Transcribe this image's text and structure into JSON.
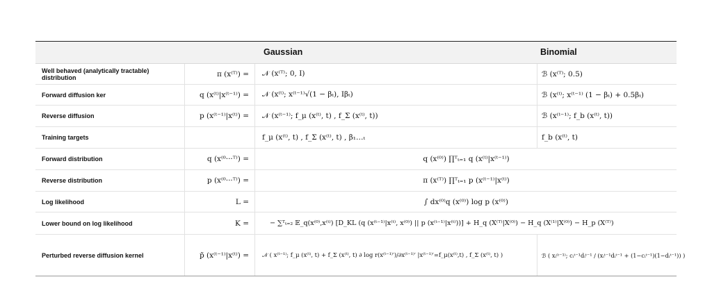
{
  "header": {
    "gaussian": "Gaussian",
    "binomial": "Binomial"
  },
  "rows": [
    {
      "name": "Well behaved (analytically tractable) distribution",
      "symbol": "π (x⁽ᵀ⁾) =",
      "gaussian": "𝒩 (x⁽ᵀ⁾; 0, I)",
      "binomial": "ℬ (x⁽ᵀ⁾; 0.5)"
    },
    {
      "name": "Forward diffusion ker",
      "symbol": "q (x⁽ᵗ⁾|x⁽ᵗ⁻¹⁾) =",
      "gaussian": "𝒩 (x⁽ᵗ⁾; x⁽ᵗ⁻¹⁾√(1 − βₜ), Iβₜ)",
      "binomial": "ℬ (x⁽ᵗ⁾; x⁽ᵗ⁻¹⁾ (1 − βₜ) + 0.5βₜ)"
    },
    {
      "name": "Reverse diffusion",
      "symbol": "p (x⁽ᵗ⁻¹⁾|x⁽ᵗ⁾) =",
      "gaussian": "𝒩 (x⁽ᵗ⁻¹⁾; f_μ (x⁽ᵗ⁾, t) , f_Σ (x⁽ᵗ⁾, t))",
      "binomial": "ℬ (x⁽ᵗ⁻¹⁾; f_b (x⁽ᵗ⁾, t))"
    },
    {
      "name": "Training targets",
      "symbol": "",
      "gaussian": "f_μ (x⁽ᵗ⁾, t) , f_Σ (x⁽ᵗ⁾, t) , β₁…ₜ",
      "binomial": "f_b (x⁽ᵗ⁾, t)"
    },
    {
      "name": "Forward distribution",
      "symbol": "q (x⁽⁰···ᵀ⁾) =",
      "shared": "q (x⁽⁰⁾) ∏ᵀₜ₌₁ q (x⁽ᵗ⁾|x⁽ᵗ⁻¹⁾)"
    },
    {
      "name": "Reverse distribution",
      "symbol": "p (x⁽⁰···ᵀ⁾) =",
      "shared": "π (x⁽ᵀ⁾) ∏ᵀₜ₌₁ p (x⁽ᵗ⁻¹⁾|x⁽ᵗ⁾)"
    },
    {
      "name": "Log likelihood",
      "symbol": "L =",
      "shared": "∫ dx⁽⁰⁾q (x⁽⁰⁾) log p (x⁽⁰⁾)"
    },
    {
      "name": "Lower bound on log likelihood",
      "symbol": "K =",
      "shared": "− ∑ᵀₜ₌₂ 𝔼_q(x⁽⁰⁾,x⁽ᵗ⁾) [D_KL (q (x⁽ᵗ⁻¹⁾|x⁽ᵗ⁾, x⁽⁰⁾) || p (x⁽ᵗ⁻¹⁾|x⁽ᵗ⁾))] + H_q (X⁽ᵀ⁾|X⁽⁰⁾) − H_q (X⁽¹⁾|X⁽⁰⁾) − H_p (X⁽ᵀ⁾)"
    },
    {
      "name": "Perturbed reverse diffusion kernel",
      "symbol": "p̃ (x⁽ᵗ⁻¹⁾|x⁽ᵗ⁾) =",
      "gaussian": "𝒩 ( x⁽ᵗ⁻¹⁾; f_μ (x⁽ᵗ⁾, t) + f_Σ (x⁽ᵗ⁾, t) ∂ log r(x⁽ᵗ⁻¹⁾′)/∂x⁽ᵗ⁻¹⁾′ |x⁽ᵗ⁻¹⁾′=f_μ(x⁽ᵗ⁾,t) , f_Σ (x⁽ᵗ⁾, t) )",
      "binomial": "ℬ ( xᵢ⁽ᵗ⁻¹⁾; cᵢᵗ⁻¹dᵢᵗ⁻¹ / (xᵢᵗ⁻¹dᵢᵗ⁻¹ + (1−cᵢᵗ⁻¹)(1−dᵢᵗ⁻¹)) )"
    }
  ]
}
